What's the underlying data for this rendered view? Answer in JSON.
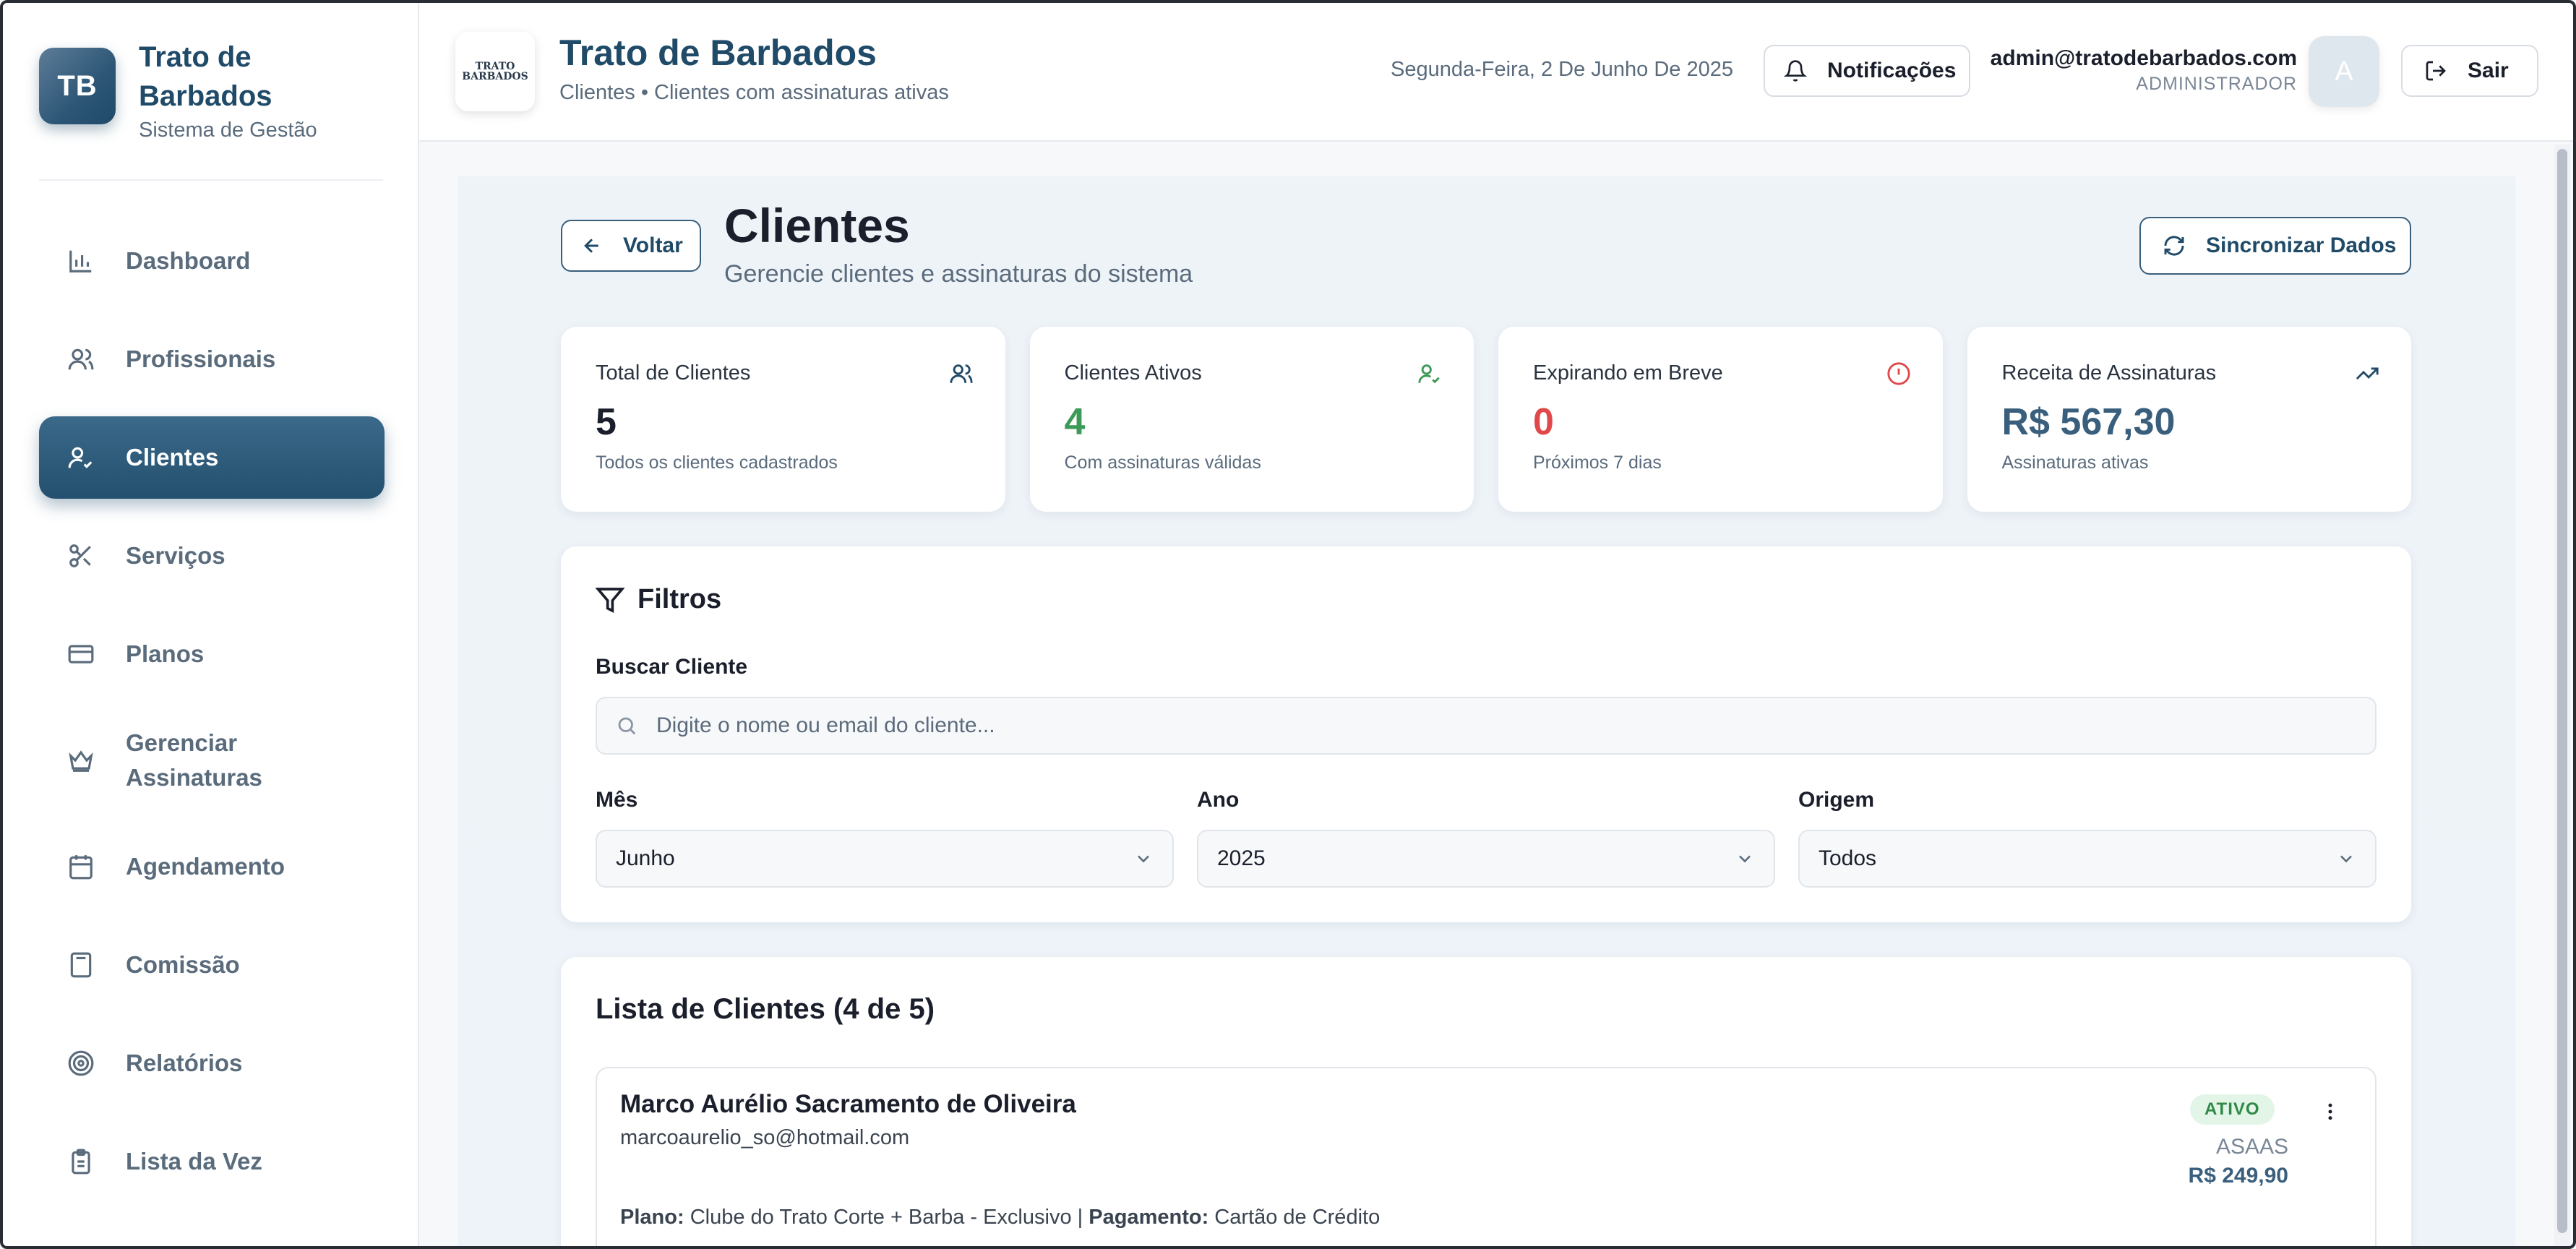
{
  "brand": {
    "logo_text": "TB",
    "title": "Trato de Barbados",
    "subtitle": "Sistema de Gestão"
  },
  "sidebar": {
    "items": [
      {
        "label": "Dashboard",
        "icon": "bar-chart-icon"
      },
      {
        "label": "Profissionais",
        "icon": "users-icon"
      },
      {
        "label": "Clientes",
        "icon": "user-check-icon",
        "active": true
      },
      {
        "label": "Serviços",
        "icon": "scissors-icon"
      },
      {
        "label": "Planos",
        "icon": "credit-card-icon"
      },
      {
        "label": "Gerenciar Assinaturas",
        "icon": "crown-icon"
      },
      {
        "label": "Agendamento",
        "icon": "calendar-icon"
      },
      {
        "label": "Comissão",
        "icon": "calculator-icon"
      },
      {
        "label": "Relatórios",
        "icon": "target-icon"
      },
      {
        "label": "Lista da Vez",
        "icon": "clipboard-list-icon"
      }
    ]
  },
  "header": {
    "logo_text_line1": "TRATO",
    "logo_text_line2": "BARBADOS",
    "title": "Trato de Barbados",
    "breadcrumb": "Clientes • Clientes com assinaturas ativas",
    "date": "Segunda-Feira, 2 De Junho De 2025",
    "notifications_label": "Notificações",
    "user_email": "admin@tratodebarbados.com",
    "user_role": "ADMINISTRADOR",
    "avatar_letter": "A",
    "logout_label": "Sair"
  },
  "page": {
    "back_label": "Voltar",
    "title": "Clientes",
    "subtitle": "Gerencie clientes e assinaturas do sistema",
    "sync_label": "Sincronizar Dados"
  },
  "stats": [
    {
      "label": "Total de Clientes",
      "value": "5",
      "sub": "Todos os clientes cadastrados",
      "color": "#1a1f2b",
      "icon": "users-icon",
      "icon_color": "#1f4a68"
    },
    {
      "label": "Clientes Ativos",
      "value": "4",
      "sub": "Com assinaturas válidas",
      "color": "#3c9a56",
      "icon": "user-check-icon",
      "icon_color": "#3c9a56"
    },
    {
      "label": "Expirando em Breve",
      "value": "0",
      "sub": "Próximos 7 dias",
      "color": "#e0484a",
      "icon": "alert-circle-icon",
      "icon_color": "#e0484a"
    },
    {
      "label": "Receita de Assinaturas",
      "value": "R$ 567,30",
      "sub": "Assinaturas ativas",
      "color": "#3a5f7c",
      "icon": "trending-up-icon",
      "icon_color": "#1f4a68"
    }
  ],
  "filters": {
    "title": "Filtros",
    "search_label": "Buscar Cliente",
    "search_placeholder": "Digite o nome ou email do cliente...",
    "month_label": "Mês",
    "month_value": "Junho",
    "year_label": "Ano",
    "year_value": "2025",
    "origin_label": "Origem",
    "origin_value": "Todos"
  },
  "list": {
    "title": "Lista de Clientes (4 de 5)",
    "clients": [
      {
        "name": "Marco Aurélio Sacramento de Oliveira",
        "email": "marcoaurelio_so@hotmail.com",
        "status": "ATIVO",
        "origin": "ASAAS",
        "price": "R$ 249,90",
        "plan_label": "Plano:",
        "plan_value": "Clube do Trato Corte + Barba - Exclusivo",
        "separator": "|",
        "payment_label": "Pagamento:",
        "payment_value": "Cartão de Crédito"
      }
    ]
  }
}
